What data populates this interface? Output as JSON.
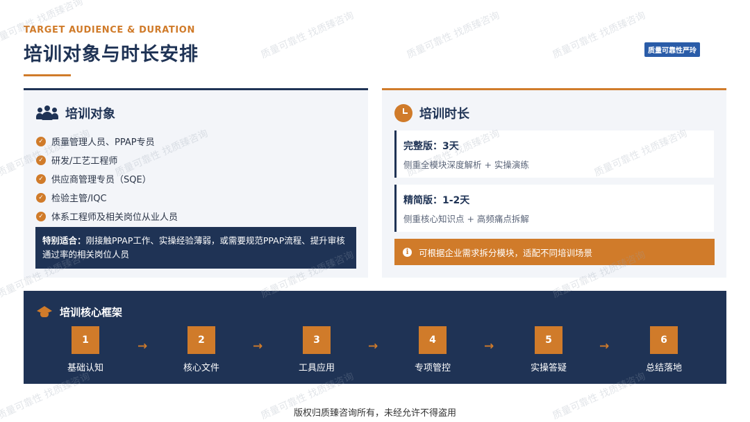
{
  "header": {
    "eyebrow": "TARGET AUDIENCE & DURATION",
    "title": "培训对象与时长安排",
    "brand_badge": "质量可靠性严玲"
  },
  "audience": {
    "title": "培训对象",
    "icon": "people-icon",
    "items": [
      "质量管理人员、PPAP专员",
      "研发/工艺工程师",
      "供应商管理专员（SQE）",
      "检验主管/IQC",
      "体系工程师及相关岗位从业人员"
    ],
    "special_label": "特别适合：",
    "special_text": "刚接触PPAP工作、实操经验薄弱，或需要规范PPAP流程、提升审核通过率的相关岗位人员"
  },
  "duration": {
    "title": "培训时长",
    "icon": "clock-icon",
    "versions": [
      {
        "name": "完整版：3天",
        "desc": "侧重全模块深度解析 + 实操演练"
      },
      {
        "name": "精简版：1-2天",
        "desc": "侧重核心知识点 + 高频痛点拆解"
      }
    ],
    "tip": "可根据企业需求拆分模块，适配不同培训场景"
  },
  "framework": {
    "title": "培训核心框架",
    "icon": "graduation-cap-icon",
    "steps": [
      {
        "num": "1",
        "label": "基础认知"
      },
      {
        "num": "2",
        "label": "核心文件"
      },
      {
        "num": "3",
        "label": "工具应用"
      },
      {
        "num": "4",
        "label": "专项管控"
      },
      {
        "num": "5",
        "label": "实操答疑"
      },
      {
        "num": "6",
        "label": "总结落地"
      }
    ],
    "arrow": "→"
  },
  "footer": "版权归质臻咨询所有，未经允许不得盗用",
  "watermark": "质量可靠性 找质臻咨询",
  "colors": {
    "navy": "#1f3355",
    "accent": "#d07b2a",
    "panel": "#f3f5f9"
  }
}
